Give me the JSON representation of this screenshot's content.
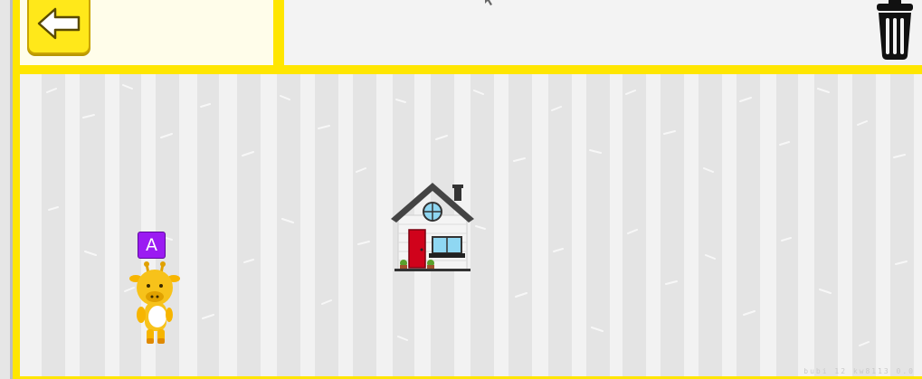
{
  "toolbar": {
    "back_icon": "left-arrow-icon",
    "trash_icon": "trash-can-icon"
  },
  "stage": {
    "background": "birch-tree-trunks",
    "house_icon": "house-icon",
    "character": {
      "label": "A",
      "sprite": "giraffe"
    },
    "footer_text": "bubi 12  kw8113  0.0"
  },
  "colors": {
    "frame": "#ffe600",
    "label_purple": "#9b1bf2",
    "door_red": "#d0021b"
  }
}
